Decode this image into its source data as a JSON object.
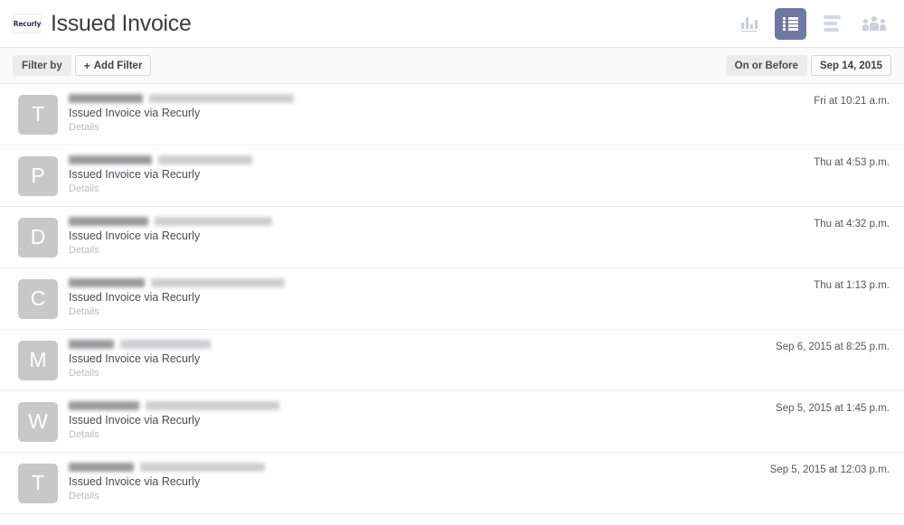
{
  "header": {
    "logo_text": "Recurly",
    "title": "Issued Invoice",
    "view_icons": [
      {
        "name": "chart-icon",
        "label": "Chart view",
        "active": false
      },
      {
        "name": "list-icon",
        "label": "List view",
        "active": true
      },
      {
        "name": "rows-icon",
        "label": "Rows view",
        "active": false
      },
      {
        "name": "people-icon",
        "label": "People view",
        "active": false
      }
    ],
    "active_accent_color": "#6f77a5"
  },
  "filter_bar": {
    "filter_by_label": "Filter by",
    "add_filter_label": "Add Filter",
    "add_filter_plus": "+",
    "date_condition_label": "On or Before",
    "date_value": "Sep 14, 2015"
  },
  "list": {
    "action_label": "Issued Invoice via Recurly",
    "details_label": "Details",
    "rows": [
      {
        "avatar_letter": "T",
        "name_width": 82,
        "email_width": 160,
        "time": "Fri at 10:21 a.m."
      },
      {
        "avatar_letter": "P",
        "name_width": 92,
        "email_width": 104,
        "time": "Thu at 4:53 p.m."
      },
      {
        "avatar_letter": "D",
        "name_width": 88,
        "email_width": 130,
        "time": "Thu at 4:32 p.m."
      },
      {
        "avatar_letter": "C",
        "name_width": 84,
        "email_width": 148,
        "time": "Thu at 1:13 p.m."
      },
      {
        "avatar_letter": "M",
        "name_width": 50,
        "email_width": 100,
        "time": "Sep 6, 2015 at 8:25 p.m."
      },
      {
        "avatar_letter": "W",
        "name_width": 78,
        "email_width": 148,
        "time": "Sep 5, 2015 at 1:45 p.m."
      },
      {
        "avatar_letter": "T",
        "name_width": 72,
        "email_width": 138,
        "time": "Sep 5, 2015 at 12:03 p.m."
      }
    ]
  },
  "colors": {
    "accent": "#6f77a5",
    "avatar_bg": "#c8c8c8",
    "border": "#e6e6e8",
    "filter_bg": "#fafafa"
  }
}
